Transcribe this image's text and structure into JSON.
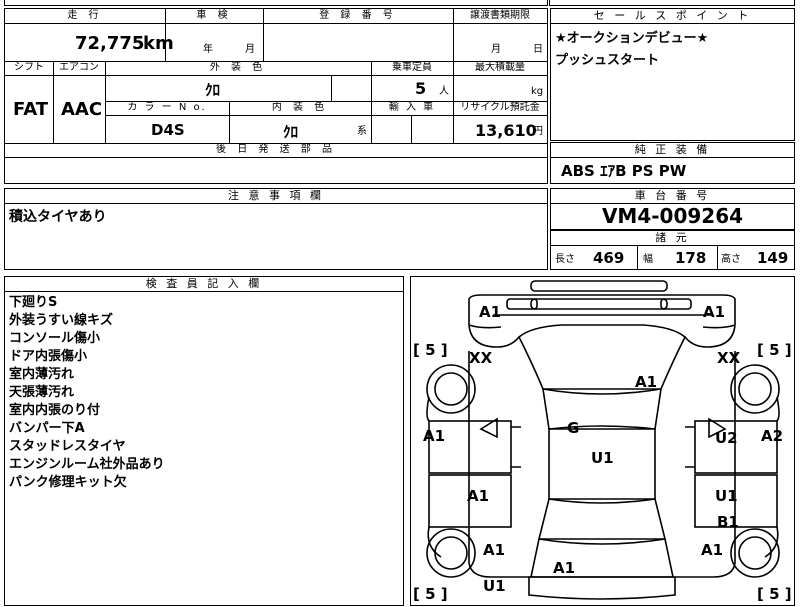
{
  "top_table": {
    "h_mileage": "走 行",
    "h_inspection": "車 検",
    "h_reg_no": "登 録 番 号",
    "h_transfer_deadline": "譲渡書類期限",
    "mileage_value": "72,775",
    "mileage_unit": "km",
    "insp_year_unit": "年",
    "insp_month_unit": "月",
    "deadline_month_unit": "月",
    "deadline_day_unit": "日",
    "h_shift": "シフト",
    "h_aircon": "エアコン",
    "h_exterior_color": "外 装 色",
    "h_capacity": "乗車定員",
    "h_max_load": "最大積載量",
    "shift_value": "FAT",
    "aircon_value": "AAC",
    "exterior_color_value": "ｸﾛ",
    "capacity_value": "5",
    "capacity_unit": "人",
    "max_load_unit": "kg",
    "h_color_no": "カ ラ ー N o.",
    "h_interior_color": "内 装 色",
    "h_import": "輸 入 車",
    "h_recycle": "リサイクル預託金",
    "color_no_value": "D4S",
    "interior_color_value": "ｸﾛ",
    "interior_color_unit": "系",
    "recycle_value": "13,610",
    "recycle_unit": "円",
    "h_later_parts": "後 日 発 送 部 品"
  },
  "sales_point": {
    "header": "セ ー ル ス ポ イ ン ト",
    "lines": [
      "★オークションデビュー★",
      "プッシュスタート"
    ]
  },
  "equipment": {
    "header": "純 正 装 備",
    "value": "ABS ｴｱB PS PW"
  },
  "notes": {
    "header": "注 意 事 項 欄",
    "value": "積込タイヤあり"
  },
  "chassis": {
    "header": "車 台 番 号",
    "value": "VM4-009264"
  },
  "specs": {
    "header": "諸 元",
    "length_label": "長さ",
    "length_value": "469",
    "width_label": "幅",
    "width_value": "178",
    "height_label": "高さ",
    "height_value": "149"
  },
  "inspector": {
    "header": "検 査 員 記 入 欄",
    "lines": [
      "下廻りS",
      "外装うすい線キズ",
      "コンソール傷小",
      "ドア内張傷小",
      "室内薄汚れ",
      "天張薄汚れ",
      "室内内張のり付",
      "バンパー下A",
      "スタッドレスタイヤ",
      "エンジンルーム社外品あり",
      "パンク修理キット欠"
    ]
  },
  "diagram": {
    "front_left": "A1",
    "front_right": "A1",
    "tire_fl": "[ 5 ]",
    "tire_fr": "[ 5 ]",
    "fender_fl": "XX",
    "fender_fr": "XX",
    "hood": "A1",
    "door_fl": "A1",
    "roof_front": "G",
    "roof": "U1",
    "door_fr": "U2",
    "side_right": "A2",
    "door_rl": "A1",
    "door_rr_1": "U1",
    "door_rr_2": "B1",
    "quarter_rl": "A1",
    "quarter_rr": "A1",
    "trunk": "A1",
    "rear_bumper": "U1",
    "tire_rl": "[ 5 ]",
    "tire_rr": "[ 5 ]"
  }
}
